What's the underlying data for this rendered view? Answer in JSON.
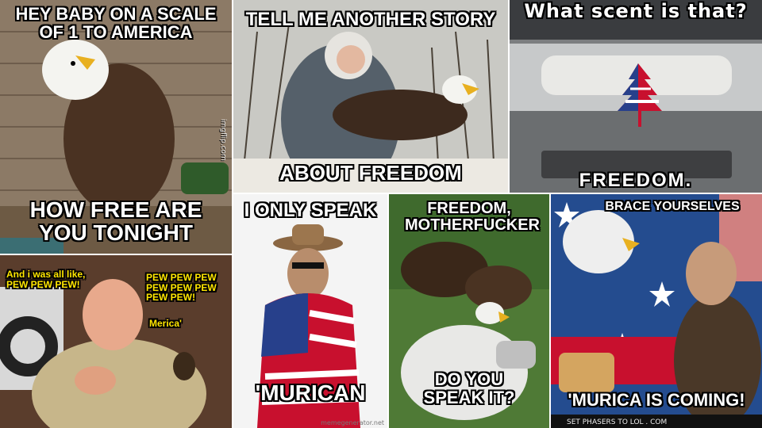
{
  "tiles": {
    "eagle_scale": {
      "top": "HEY BABY ON A SCALE OF 1 TO AMERICA",
      "bottom": "HOW FREE ARE YOU TONIGHT",
      "watermark": "imgflip.com"
    },
    "story": {
      "top": "TELL ME ANOTHER STORY",
      "bottom": "ABOUT FREEDOM"
    },
    "scent": {
      "top": "What scent is that?",
      "bottom": "FREEDOM."
    },
    "sheriff": {
      "left": "And i was all like, PEW PEW PEW!",
      "right": "PEW PEW PEW PEW PEW PEW PEW PEW!",
      "middle": "Merica'"
    },
    "murican": {
      "top": "I ONLY SPEAK",
      "bottom": "'MURICAN",
      "watermark": "memegenerator.net"
    },
    "freedom_eagle": {
      "top": "FREEDOM, MOTHERFUCKER",
      "bottom": "DO YOU SPEAK IT?"
    },
    "brace": {
      "top": "BRACE YOURSELVES",
      "bottom": "'MURICA IS COMING!",
      "footer": "SET PHASERS TO LOL . COM"
    }
  },
  "colors": {
    "caption": "#ffffff",
    "outline": "#000000",
    "sheriff_text": "#ffe600"
  },
  "icons": [
    "bald-eagle",
    "flag-air-freshener",
    "cowboy-hat",
    "american-flag",
    "revolver-hands"
  ]
}
